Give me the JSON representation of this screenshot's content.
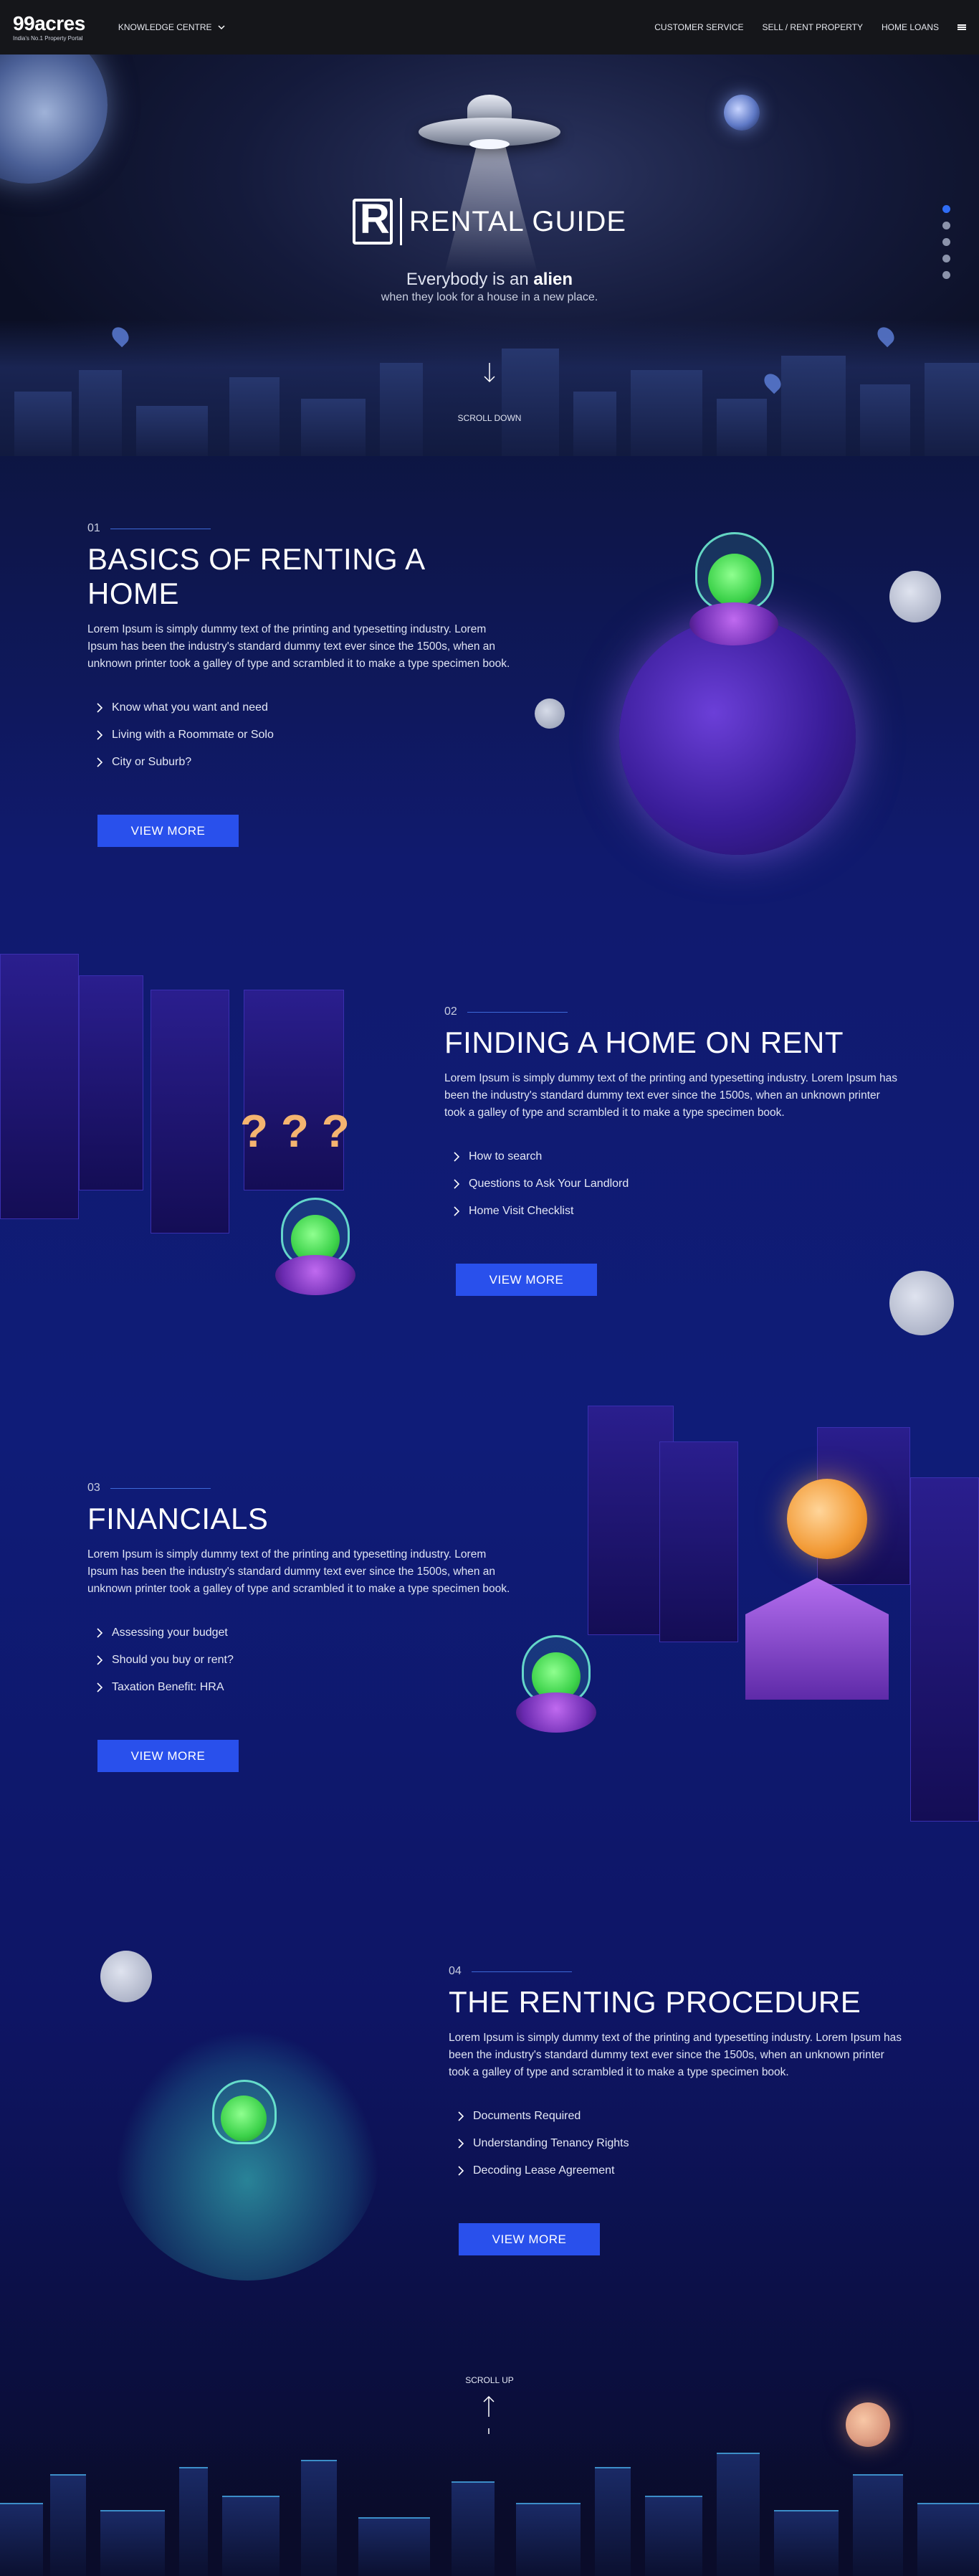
{
  "header": {
    "logo_main": "99acres",
    "logo_sub": "India's No.1 Property Portal",
    "knowledge_centre": "KNOWLEDGE CENTRE",
    "nav": [
      "CUSTOMER SERVICE",
      "SELL / RENT PROPERTY",
      "HOME LOANS"
    ]
  },
  "hero": {
    "guide_title": "RENTAL GUIDE",
    "tagline_prefix": "Everybody is an",
    "tagline_bold": "alien",
    "tagline2": "when they look for a house in a new place.",
    "scroll_down": "SCROLL DOWN"
  },
  "sections": [
    {
      "num": "01",
      "title": "BASICS OF RENTING A HOME",
      "desc": "Lorem Ipsum is simply dummy text of the printing and typesetting industry. Lorem Ipsum has been the industry's standard dummy text ever since the 1500s, when an unknown printer took a galley of type and scrambled it to make a type specimen book.",
      "items": [
        "Know what you want and need",
        "Living with a Roommate or Solo",
        "City or Suburb?"
      ],
      "button": "VIEW MORE"
    },
    {
      "num": "02",
      "title": "FINDING A HOME ON RENT",
      "desc": "Lorem Ipsum is simply dummy text of the printing and typesetting industry. Lorem Ipsum has been the industry's standard dummy text ever since the 1500s, when an unknown printer took a galley of type and scrambled it to make a type specimen book.",
      "items": [
        "How to search",
        "Questions to Ask Your Landlord",
        "Home Visit Checklist"
      ],
      "button": "VIEW MORE"
    },
    {
      "num": "03",
      "title": "FINANCIALS",
      "desc": "Lorem Ipsum is simply dummy text of the printing and typesetting industry. Lorem Ipsum has been the industry's standard dummy text ever since the 1500s, when an unknown printer took a galley of type and scrambled it to make a type specimen book.",
      "items": [
        "Assessing your budget",
        "Should you buy or rent?",
        "Taxation Benefit: HRA"
      ],
      "button": "VIEW MORE"
    },
    {
      "num": "04",
      "title": "THE RENTING PROCEDURE",
      "desc": "Lorem Ipsum is simply dummy text of the printing and typesetting industry. Lorem Ipsum has been the industry's standard dummy text ever since the 1500s, when an unknown printer took a galley of type and scrambled it to make a type specimen book.",
      "items": [
        "Documents Required",
        "Understanding Tenancy Rights",
        "Decoding Lease Agreement"
      ],
      "button": "VIEW MORE"
    }
  ],
  "footer": {
    "scroll_up": "SCROLL UP"
  },
  "colors": {
    "accent": "#2950ec",
    "active_dot": "#2f6df6"
  },
  "dots": {
    "count": 5,
    "active": 1
  }
}
